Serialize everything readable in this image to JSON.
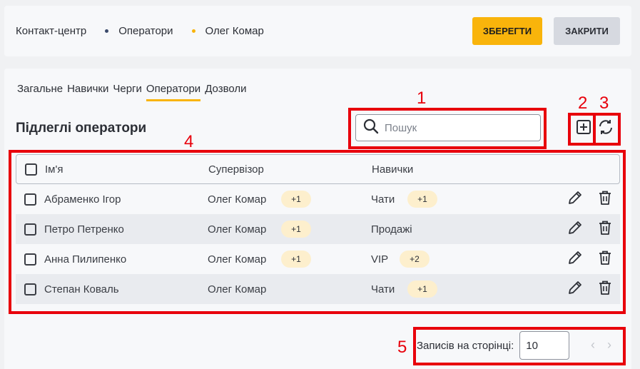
{
  "header": {
    "breadcrumb": [
      "Контакт-центр",
      "Оператори",
      "Олег Комар"
    ],
    "breadcrumb_dot_colors": [
      "#3b4a6b",
      "#f9b40b"
    ],
    "save_label": "ЗБЕРЕГТИ",
    "close_label": "ЗАКРИТИ"
  },
  "tabs": [
    "Загальне",
    "Навички",
    "Черги",
    "Оператори",
    "Дозволи"
  ],
  "active_tab": "Оператори",
  "section_title": "Підлеглі оператори",
  "search": {
    "placeholder": "Пошук",
    "value": ""
  },
  "table": {
    "columns": [
      "Ім'я",
      "Супервізор",
      "Навички"
    ],
    "rows": [
      {
        "name": "Абраменко Ігор",
        "supervisor": "Олег Комар",
        "supervisor_badge": "+1",
        "skill": "Чати",
        "skill_badge": "+1"
      },
      {
        "name": "Петро Петренко",
        "supervisor": "Олег Комар",
        "supervisor_badge": "+1",
        "skill": "Продажі",
        "skill_badge": ""
      },
      {
        "name": "Анна Пилипенко",
        "supervisor": "Олег Комар",
        "supervisor_badge": "+1",
        "skill": "VIP",
        "skill_badge": "+2"
      },
      {
        "name": "Степан Коваль",
        "supervisor": "Олег Комар",
        "supervisor_badge": "",
        "skill": "Чати",
        "skill_badge": "+1"
      }
    ]
  },
  "pagination": {
    "label": "Записів на сторінці:",
    "page_size": "10"
  },
  "annotations": [
    "1",
    "2",
    "3",
    "4",
    "5"
  ],
  "colors": {
    "accent": "#f9b40b",
    "annotation": "#e8000b",
    "badge_bg": "#fdefcd"
  },
  "icons": [
    "plus-square-icon",
    "refresh-icon",
    "search-icon",
    "pencil-icon",
    "trash-icon",
    "chevron-left-icon",
    "chevron-right-icon"
  ]
}
